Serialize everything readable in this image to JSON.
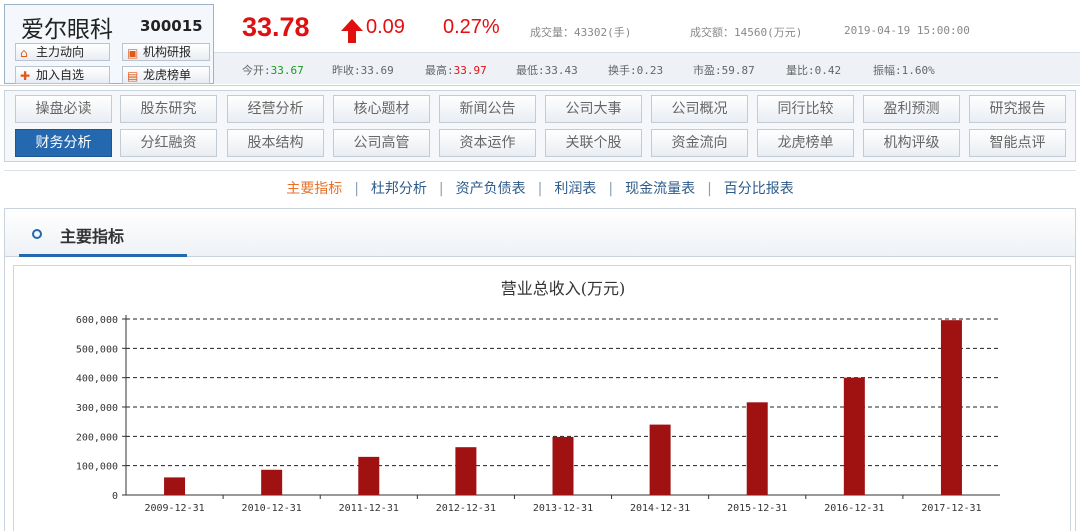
{
  "header": {
    "stock_name": "爱尔眼科",
    "stock_code": "300015",
    "buttons": {
      "zhuli": "主力动向",
      "jigou": "机构研报",
      "jiaru": "加入自选",
      "longhu": "龙虎榜单"
    },
    "price": "33.78",
    "change": "0.09",
    "change_pct": "0.27%",
    "volume": "成交量：43302(手)",
    "turnover": "成交额：14560(万元)",
    "datetime": "2019-04-19 15:00:00",
    "details": {
      "open_label": "今开:",
      "open": "33.67",
      "prev_close": "昨收:33.69",
      "high_label": "最高:",
      "high": "33.97",
      "low": "最低:33.43",
      "turnover_rate": "换手:0.23",
      "pe": "市盈:59.87",
      "volume_ratio": "量比:0.42",
      "amplitude": "振幅:1.60%"
    },
    "colors": {
      "up": "#e01010",
      "open_value": "#1a9a1a"
    }
  },
  "nav": {
    "row1": [
      "操盘必读",
      "股东研究",
      "经营分析",
      "核心题材",
      "新闻公告",
      "公司大事",
      "公司概况",
      "同行比较",
      "盈利预测",
      "研究报告"
    ],
    "row2": [
      "财务分析",
      "分红融资",
      "股本结构",
      "公司高管",
      "资本运作",
      "关联个股",
      "资金流向",
      "龙虎榜单",
      "机构评级",
      "智能点评"
    ],
    "active": "财务分析"
  },
  "subtabs": {
    "items": [
      "主要指标",
      "杜邦分析",
      "资产负债表",
      "利润表",
      "现金流量表",
      "百分比报表"
    ],
    "active": "主要指标"
  },
  "section": {
    "title": "主要指标"
  },
  "chart_data": {
    "type": "bar",
    "title": "营业总收入(万元)",
    "categories": [
      "2009-12-31",
      "2010-12-31",
      "2011-12-31",
      "2012-12-31",
      "2013-12-31",
      "2014-12-31",
      "2015-12-31",
      "2016-12-31",
      "2017-12-31"
    ],
    "values": [
      60000,
      86000,
      130000,
      163000,
      198000,
      240000,
      316000,
      400000,
      596000
    ],
    "y_ticks": [
      "0",
      "100,000",
      "200,000",
      "300,000",
      "400,000",
      "500,000",
      "600,000"
    ],
    "ylim": [
      0,
      600000
    ],
    "grid": "dashed-horizontal",
    "bar_color": "#a01212",
    "xlabel": "",
    "ylabel": ""
  }
}
